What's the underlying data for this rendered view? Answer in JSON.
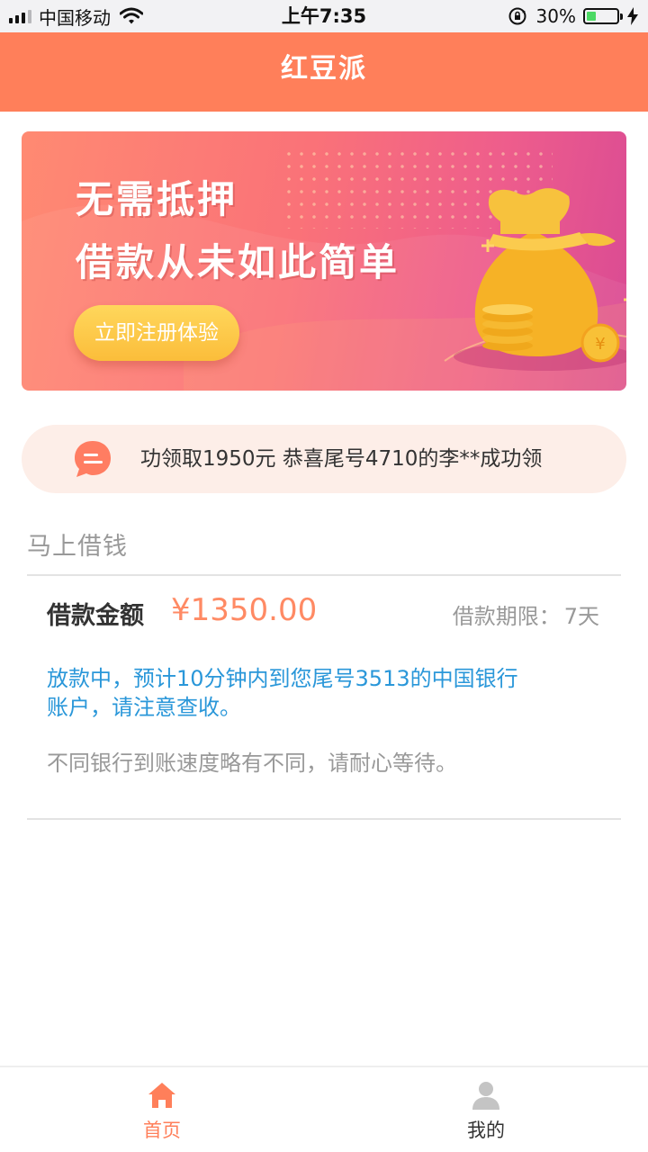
{
  "status_bar": {
    "carrier": "中国移动",
    "time": "上午7:35",
    "battery_percent": "30%",
    "battery_level": 0.3,
    "icons": [
      "signal-icon",
      "wifi-icon",
      "rotation-lock-icon",
      "battery-icon",
      "charging-icon"
    ]
  },
  "header": {
    "title": "红豆派",
    "color": "#ff7f5a"
  },
  "banner": {
    "line1": "无需抵押",
    "line2": "借款从未如此简单",
    "cta_label": "立即注册体验",
    "coin_symbol": "¥"
  },
  "notice": {
    "icon": "message-bubble-icon",
    "text": "功领取1950元 恭喜尾号4710的李**成功领"
  },
  "loan": {
    "section_title": "马上借钱",
    "amount_label": "借款金额",
    "amount_value": "¥1350.00",
    "term_label": "借款期限：",
    "term_value": "7天",
    "status_message": "放款中，预计10分钟内到您尾号3513的中国银行账户，请注意查收。",
    "hint": "不同银行到账速度略有不同，请耐心等待。",
    "accent_color": "#ff8a64",
    "status_color": "#2a97d9"
  },
  "tabbar": {
    "tabs": [
      {
        "label": "首页",
        "icon": "home-icon",
        "active": true
      },
      {
        "label": "我的",
        "icon": "user-icon",
        "active": false
      }
    ]
  }
}
